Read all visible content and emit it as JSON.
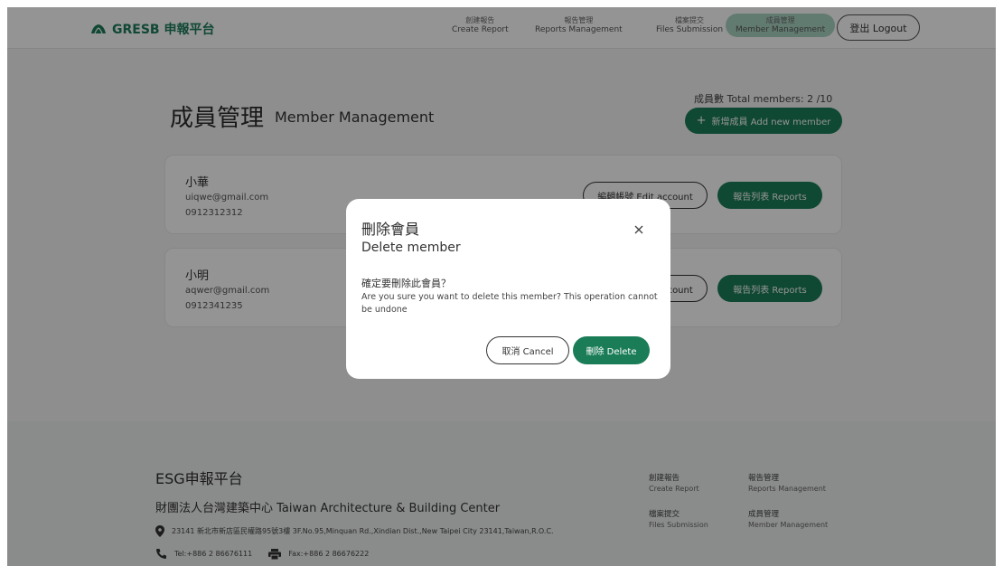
{
  "header": {
    "logo_text": "GRESB 申報平台",
    "nav": [
      {
        "zh": "創建報告",
        "en": "Create Report"
      },
      {
        "zh": "報告管理",
        "en": "Reports Management"
      },
      {
        "zh": "檔案提交",
        "en": "Files Submission"
      },
      {
        "zh": "成員管理",
        "en": "Member Management"
      }
    ],
    "logout_label": "登出 Logout"
  },
  "main": {
    "title_zh": "成員管理",
    "title_en": "Member Management",
    "member_count": "成員數 Total members: 2 /10",
    "add_button_label": "新增成員 Add new member",
    "members": [
      {
        "name": "小華",
        "email": "uiqwe@gmail.com",
        "phone": "0912312312",
        "edit_label": "編輯帳號 Edit account",
        "reports_label": "報告列表 Reports"
      },
      {
        "name": "小明",
        "email": "aqwer@gmail.com",
        "phone": "0912341235",
        "edit_label": "編輯帳號 Edit account",
        "reports_label": "報告列表 Reports"
      }
    ]
  },
  "modal": {
    "title_zh": "刪除會員",
    "title_en": "Delete member",
    "question": "確定要刪除此會員？",
    "description": "Are you sure you want to delete this member? This operation cannot be undone",
    "cancel_label": "取消 Cancel",
    "delete_label": "刪除 Delete"
  },
  "footer": {
    "title": "ESG申報平台",
    "org": "財團法人台灣建築中心 Taiwan Architecture & Building Center",
    "address": "23141 新北市新店區民權路95號3樓 3F.No.95,Minquan Rd.,Xindian Dist.,New Taipei City 23141,Taiwan,R.O.C.",
    "tel": "Tel:+886 2 86676111",
    "fax": "Fax:+886 2 86676222",
    "links": [
      {
        "zh": "創建報告",
        "en": "Create Report"
      },
      {
        "zh": "報告管理",
        "en": "Reports Management"
      },
      {
        "zh": "檔案提交",
        "en": "Files Submission"
      },
      {
        "zh": "成員管理",
        "en": "Member Management"
      }
    ]
  },
  "colors": {
    "accent": "#1b7d58",
    "nav_active": "#a9d5c3",
    "overlay": "rgba(0,0,0,0.42)"
  }
}
